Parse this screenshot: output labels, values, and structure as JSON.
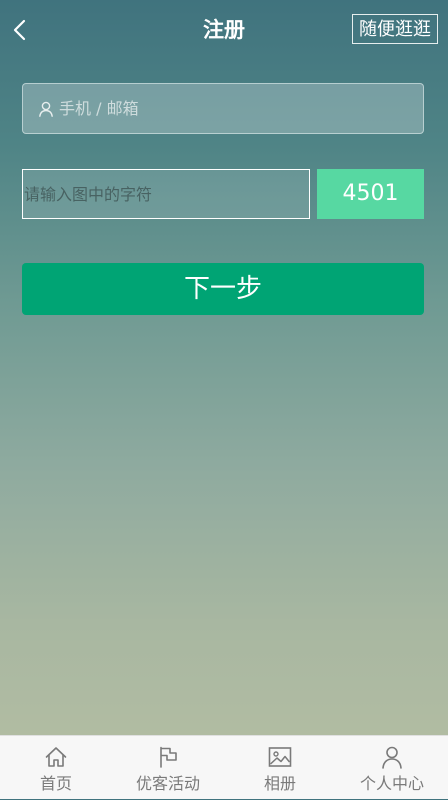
{
  "header": {
    "title": "注册",
    "back_icon": "chevron-left-icon",
    "browse_label": "随便逛逛"
  },
  "form": {
    "account_placeholder": "手机 / 邮箱",
    "account_icon": "user-icon",
    "captcha_placeholder": "请输入图中的字符",
    "captcha_code": "4501",
    "next_label": "下一步"
  },
  "tabbar": {
    "items": [
      {
        "label": "首页",
        "icon": "home-icon"
      },
      {
        "label": "优客活动",
        "icon": "flag-icon"
      },
      {
        "label": "相册",
        "icon": "image-icon"
      },
      {
        "label": "个人中心",
        "icon": "person-icon"
      }
    ]
  },
  "colors": {
    "primary_button": "#00a474",
    "captcha_bg": "#57d8a2",
    "background_top": "#40737e",
    "background_bottom": "#b4bda3",
    "tabbar_bg": "#f7f7f7",
    "tab_text": "#7a7a7a"
  }
}
